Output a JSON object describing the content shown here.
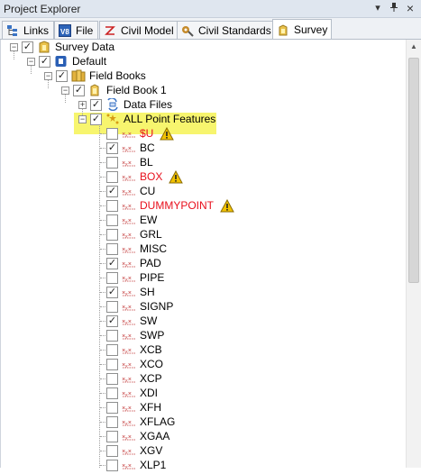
{
  "window": {
    "title": "Project Explorer",
    "pin_glyph": "ᵖ",
    "close_glyph": "×",
    "dropdown_glyph": "▾"
  },
  "tabs": [
    {
      "label": "Links",
      "icon": "links-icon"
    },
    {
      "label": "File",
      "icon": "file-icon"
    },
    {
      "label": "Civil Model",
      "icon": "civil-model-icon"
    },
    {
      "label": "Civil Standards",
      "icon": "civil-standards-icon"
    },
    {
      "label": "Survey",
      "icon": "survey-icon",
      "active": true
    }
  ],
  "tree": {
    "survey_data": "Survey Data",
    "default": "Default",
    "field_books": "Field Books",
    "field_book_1": "Field Book 1",
    "data_files": "Data Files",
    "all_point_features": "ALL Point Features",
    "features": [
      {
        "label": "$U",
        "checked": false,
        "error": true,
        "warning": true
      },
      {
        "label": "BC",
        "checked": true
      },
      {
        "label": "BL",
        "checked": false
      },
      {
        "label": "BOX",
        "checked": false,
        "error": true,
        "warning": true
      },
      {
        "label": "CU",
        "checked": true
      },
      {
        "label": "DUMMYPOINT",
        "checked": false,
        "error": true,
        "warning": true
      },
      {
        "label": "EW",
        "checked": false
      },
      {
        "label": "GRL",
        "checked": false
      },
      {
        "label": "MISC",
        "checked": false
      },
      {
        "label": "PAD",
        "checked": true
      },
      {
        "label": "PIPE",
        "checked": false
      },
      {
        "label": "SH",
        "checked": true
      },
      {
        "label": "SIGNP",
        "checked": false
      },
      {
        "label": "SW",
        "checked": true
      },
      {
        "label": "SWP",
        "checked": false
      },
      {
        "label": "XCB",
        "checked": false
      },
      {
        "label": "XCO",
        "checked": false
      },
      {
        "label": "XCP",
        "checked": false
      },
      {
        "label": "XDI",
        "checked": false
      },
      {
        "label": "XFH",
        "checked": false
      },
      {
        "label": "XFLAG",
        "checked": false
      },
      {
        "label": "XGAA",
        "checked": false
      },
      {
        "label": "XGV",
        "checked": false
      },
      {
        "label": "XLP1",
        "checked": false
      }
    ]
  },
  "colors": {
    "highlight": "#f7f56e",
    "error_text": "#e8101d",
    "warning": "#f2c200"
  }
}
